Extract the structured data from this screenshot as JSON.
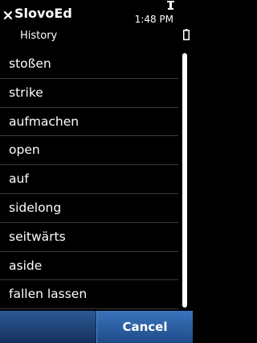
{
  "header": {
    "app_title": "SlovoEd",
    "subtitle": "History",
    "clock": "1:48 PM"
  },
  "icons": {
    "close": "close-icon",
    "signal": "signal-icon",
    "battery": "battery-icon"
  },
  "history": {
    "items": [
      "stoßen",
      "strike",
      "aufmachen",
      "open",
      "auf",
      "sidelong",
      "seitwärts",
      "aside",
      "fallen lassen"
    ]
  },
  "scroll": {
    "visible_fraction": 1.0
  },
  "softkeys": {
    "cancel_label": "Cancel"
  },
  "colors": {
    "background": "#000000",
    "softkey_bar": "#1a3d6b",
    "cancel_button": "#3a74bd",
    "separator": "#3a3a3a"
  }
}
